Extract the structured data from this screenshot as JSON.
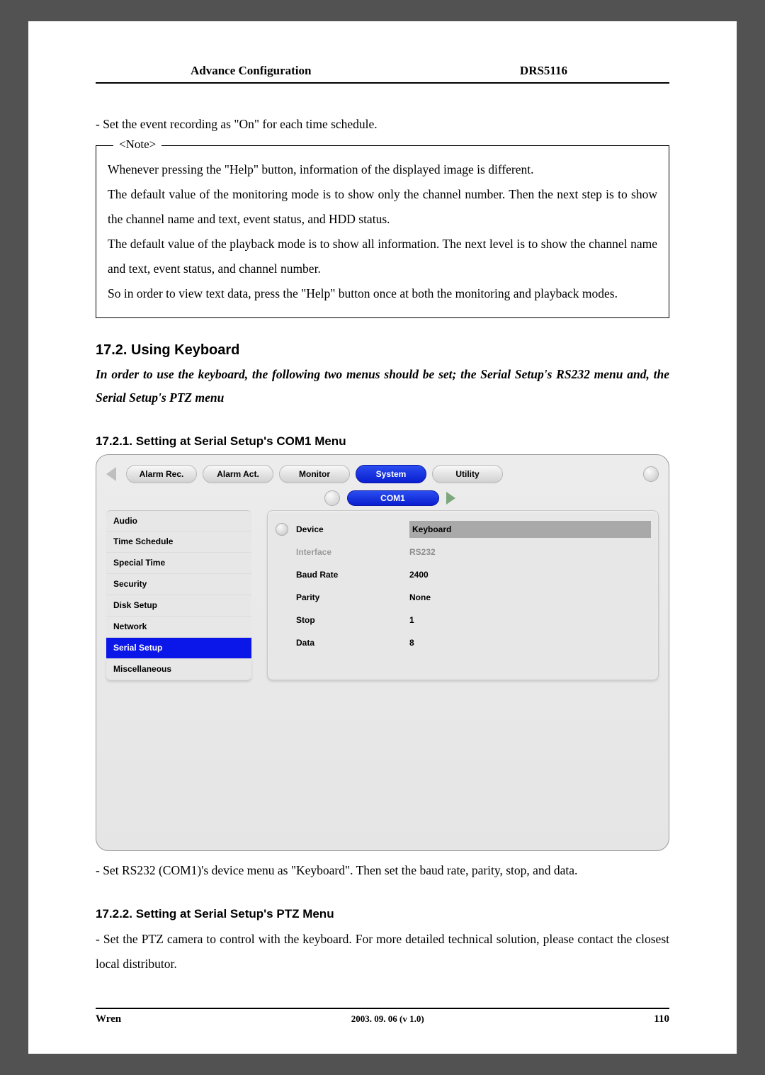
{
  "header": {
    "left": "Advance Configuration",
    "right": "DRS5116"
  },
  "bullet1": "- Set the event recording as \"On\" for each time schedule.",
  "note": {
    "label": "<Note>",
    "p1": "Whenever pressing the \"Help\" button, information of the displayed image is different.",
    "p2": "The default value of the monitoring mode is to show only the channel number.    Then the next step is to show the channel name and text, event status, and HDD status.",
    "p3": "The default value of the playback mode is to show all information.   The next level is to show the channel name and text, event status, and channel number.",
    "p4": "So in order to view text data, press the \"Help\" button once at both the monitoring and playback modes."
  },
  "s172": {
    "title": "17.2. Using Keyboard",
    "intro": "In order to use the keyboard, the following two menus should be set; the Serial Setup's RS232 menu and, the Serial Setup's PTZ menu"
  },
  "s1721": {
    "title": "17.2.1. Setting at Serial Setup's COM1 Menu",
    "after": "- Set RS232 (COM1)'s device menu as \"Keyboard\".    Then set the baud rate, parity, stop, and data."
  },
  "s1722": {
    "title": "17.2.2. Setting at Serial Setup's PTZ Menu",
    "after": "- Set the PTZ camera to control with the keyboard.   For more detailed technical solution, please contact the closest local distributor."
  },
  "ui": {
    "tabs": [
      "Alarm Rec.",
      "Alarm Act.",
      "Monitor",
      "System",
      "Utility"
    ],
    "activeTab": "System",
    "subLabel": "COM1",
    "side": [
      "Audio",
      "Time Schedule",
      "Special Time",
      "Security",
      "Disk Setup",
      "Network",
      "Serial Setup",
      "Miscellaneous"
    ],
    "activeSide": "Serial Setup",
    "rows": {
      "r0": {
        "k": "Device",
        "v": "Keyboard"
      },
      "r1": {
        "k": "Interface",
        "v": "RS232"
      },
      "r2": {
        "k": "Baud Rate",
        "v": "2400"
      },
      "r3": {
        "k": "Parity",
        "v": "None"
      },
      "r4": {
        "k": "Stop",
        "v": "1"
      },
      "r5": {
        "k": "Data",
        "v": "8"
      }
    }
  },
  "footer": {
    "left": "Wren",
    "center": "2003. 09. 06 (v 1.0)",
    "right": "110"
  }
}
